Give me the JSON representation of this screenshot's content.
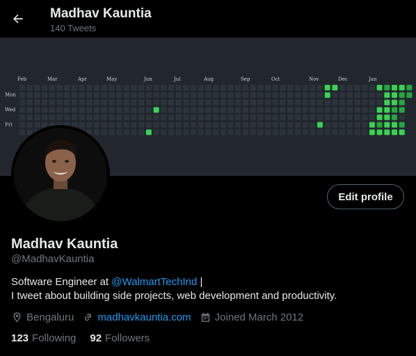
{
  "header": {
    "name": "Madhav Kauntia",
    "tweet_count": "140 Tweets",
    "back_icon": "arrow-left-icon"
  },
  "banner": {
    "months": [
      "Feb",
      "Mar",
      "Apr",
      "May",
      "Jun",
      "Jul",
      "Aug",
      "Sep",
      "Oct",
      "Nov",
      "Dec",
      "Jan"
    ],
    "day_labels": [
      "Mon",
      "Wed",
      "Fri"
    ],
    "colors": {
      "background": "#22272e",
      "empty": "#2d333b",
      "bright": "#39d353",
      "mid": "#26a641",
      "dim": "#006d32"
    }
  },
  "profile": {
    "name": "Madhav Kauntia",
    "handle": "@MadhavKauntia",
    "edit_button": "Edit profile",
    "bio_prefix": "Software Engineer at ",
    "bio_mention": "@WalmartTechInd",
    "bio_suffix": " |",
    "bio_line2": "I tweet about building side projects, web development and productivity.",
    "location": "Bengaluru",
    "website": "madhavkauntia.com",
    "joined": "Joined March 2012",
    "following_count": "123",
    "following_label": "Following",
    "followers_count": "92",
    "followers_label": "Followers"
  }
}
